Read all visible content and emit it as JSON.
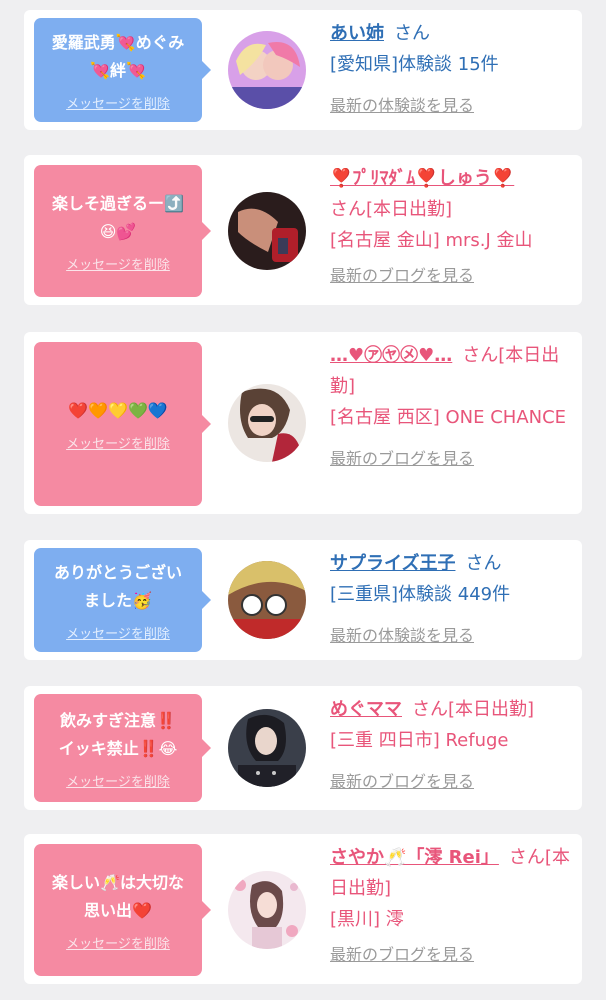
{
  "colors": {
    "background": "#efeff1",
    "card": "#ffffff",
    "bubble_blue": "#7eaef0",
    "bubble_pink": "#f58aa2",
    "text_blue": "#2f6fb5",
    "text_pink": "#e8557a",
    "link_gray": "#9a9a9a"
  },
  "items": [
    {
      "message": "愛羅武勇💘めぐみ\n💘絆💘",
      "delete_label": "メッセージを削除",
      "name": "あい姉",
      "suffix": "さん",
      "detail": "[愛知県]体験談 15件",
      "latest": "最新の体験談を見る"
    },
    {
      "message": "楽しそ過ぎるー⤴️\n😆💕",
      "delete_label": "メッセージを削除",
      "name": "❣️ﾌﾟﾘﾏﾀﾞﾑ❣️しゅう❣️",
      "suffix": "さん[本日出勤]",
      "detail": "[名古屋 金山] mrs.J 金山",
      "latest": "最新のブログを見る"
    },
    {
      "message": "❤️🧡💛💚💙",
      "delete_label": "メッセージを削除",
      "name": "…♥㋐㋳㋱♥…",
      "suffix": "さん[本日出勤]",
      "detail": "[名古屋 西区] ONE CHANCE",
      "latest": "最新のブログを見る"
    },
    {
      "message": "ありがとうござい\nました🥳",
      "delete_label": "メッセージを削除",
      "name": "サプライズ王子",
      "suffix": "さん",
      "detail": "[三重県]体験談 449件",
      "latest": "最新の体験談を見る"
    },
    {
      "message": "飲みすぎ注意‼️\nイッキ禁止‼️😂",
      "delete_label": "メッセージを削除",
      "name": "めぐママ",
      "suffix": "さん[本日出勤]",
      "detail": "[三重 四日市] Refuge",
      "latest": "最新のブログを見る"
    },
    {
      "message": "楽しい🥂は大切な\n思い出❤️",
      "delete_label": "メッセージを削除",
      "name": "さやか🥂「澪 Rei」",
      "suffix": "さん[本日出勤]",
      "detail": "[黒川] 澪",
      "latest": "最新のブログを見る"
    }
  ]
}
